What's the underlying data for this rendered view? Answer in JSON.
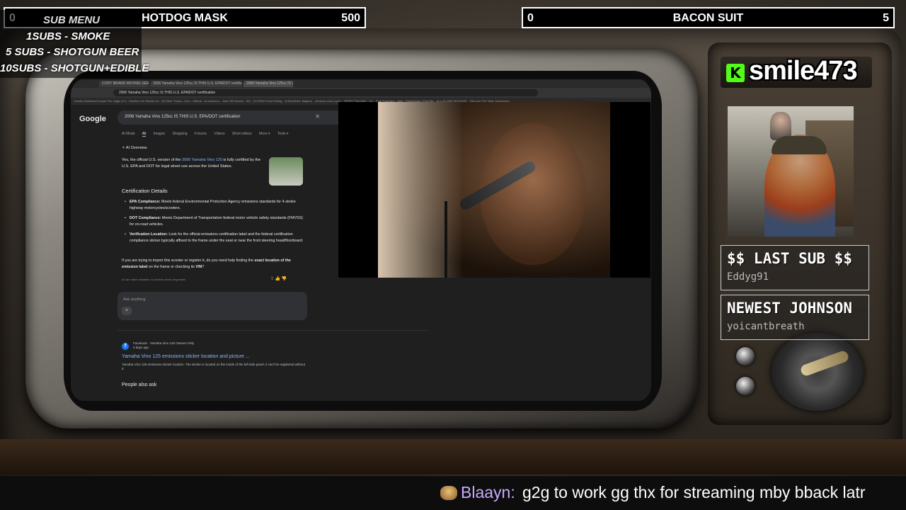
{
  "top_left_bar": {
    "count": "0",
    "title": "HOTDOG MASK",
    "goal": "500"
  },
  "top_right_bar": {
    "count": "0",
    "title": "BACON SUIT",
    "goal": "5"
  },
  "sub_menu": {
    "heading": "SUB MENU",
    "items": [
      "1SUBS   - SMOKE",
      "5 SUBS  - SHOTGUN BEER",
      "10SUBS - SHOTGUN+EDIBLE"
    ]
  },
  "streamer": {
    "name": "smile473",
    "platform_icon": "K"
  },
  "last_sub": {
    "label": "$$ LAST SUB $$",
    "value": "Eddyg91"
  },
  "newest_johnson": {
    "label": "NEWEST JOHNSON",
    "value": "yoicantbreath"
  },
  "chat": {
    "user": "Blaayn:",
    "message": "g2g to work gg thx for streaming mby bback latr",
    "emote": "burger-emote"
  },
  "browser": {
    "tabs": [
      "CODY BRAND MOVING SERV...",
      "2006 Yamaha Vino 125cc IS THIS U.S. EPA/DOT certification",
      "2006 Yamaha Vino 125cc IS T"
    ],
    "address": "2006 Yamaha Vino 125cc IS THIS U.S. EPA/DOT certification",
    "bookmarks": "Creator Dashboard   Import The magic of 3...   Monitors On Stream Us...   All Other Tracks - Goo...   GitHub - ac-custom-s...   Axis C99 Screen - We...   ECOPAY Excel Rolling...   A Wonderful, Magical ...   Amazon.com Log In...   VERIFY Repeater - Ca...   Chat Translator - Add...   FreshClown | Fruit Sle...   ALL-IN-ONE PACKAGE...   Ollo.com   The Vault: Aggressive...",
    "google_logo": "Google",
    "query": "2006 Yamaha Vino 125cc IS THIS U.S. EPA/DOT certification",
    "nav_tabs": [
      "AI Mode",
      "All",
      "Images",
      "Shopping",
      "Forums",
      "Videos",
      "Short videos",
      "More ▾",
      "Tools ▾"
    ],
    "ai_overview": "AI Overview",
    "ai_intro_1": "Yes, the official U.S. version of the ",
    "ai_intro_hl": "2006 Yamaha Vino 125",
    "ai_intro_2": " is fully certified by the U.S. EPA and DOT for legal street use across the United States.",
    "cert_title": "Certification Details",
    "cert_items": [
      {
        "bold": "EPA Compliance:",
        "text": " Meets federal Environmental Protection Agency emissions standards for 4-stroke highway motorcycles/scooters."
      },
      {
        "bold": "DOT Compliance:",
        "text": " Meets Department of Transportation federal motor vehicle safety standards (FMVSS) for on-road vehicles."
      },
      {
        "bold": "Verification Location:",
        "text": " Look for the official emissions certification label and the federal certification compliance sticker typically affixed to the frame under the seat or near the front steering head/floorboard."
      }
    ],
    "advice_1": "If you are trying to import this scooter or register it, do you need help finding the ",
    "advice_bold": "exact location of the emission label",
    "advice_2": " on the frame or checking its ",
    "advice_vin": "VIN",
    "advice_end": "?",
    "disclaimer": "AI can make mistakes, so double-check responses",
    "ask_placeholder": "Ask anything",
    "fb_source": "Facebook · Yamaha Vino 125 Owners Only",
    "fb_date": "4 days ago",
    "fb_title": "Yamaha Vino 125 emissions sticker location and picture ...",
    "fb_snippet": "Yamaha Vino 125 emissions sticker location. The sticker is located on the inside of the left side panel, it can't be registered without it.",
    "people_also_ask": "People also ask"
  }
}
